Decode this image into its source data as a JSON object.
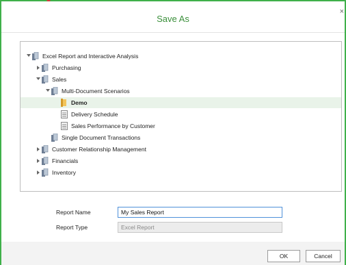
{
  "dialog": {
    "title": "Save As",
    "close_glyph": "×"
  },
  "tree": [
    {
      "label": "Excel Report and Interactive Analysis",
      "expanded": true,
      "icon": "document-folder-icon"
    },
    {
      "label": "Purchasing",
      "expanded": false,
      "icon": "document-folder-icon"
    },
    {
      "label": "Sales",
      "expanded": true,
      "icon": "document-folder-icon"
    },
    {
      "label": "Multi-Document Scenarios",
      "expanded": true,
      "icon": "document-folder-icon"
    },
    {
      "label": "Demo",
      "selected": true,
      "icon": "folder-icon"
    },
    {
      "label": "Delivery Schedule",
      "icon": "report-icon"
    },
    {
      "label": "Sales Performance by Customer",
      "icon": "report-icon"
    },
    {
      "label": "Single Document Transactions",
      "icon": "document-folder-icon"
    },
    {
      "label": "Customer Relationship Management",
      "expanded": false,
      "icon": "document-folder-icon"
    },
    {
      "label": "Financials",
      "expanded": false,
      "icon": "document-folder-icon"
    },
    {
      "label": "Inventory",
      "expanded": false,
      "icon": "document-folder-icon"
    }
  ],
  "form": {
    "report_name_label": "Report Name",
    "report_name_value": "My Sales Report",
    "report_type_label": "Report Type",
    "report_type_value": "Excel Report"
  },
  "buttons": {
    "ok": "OK",
    "cancel": "Cancel"
  },
  "colors": {
    "accent_green": "#3fb04a",
    "title_green": "#3a8f3a",
    "selection": "#e9f3e9",
    "focus_blue": "#4d90d9"
  }
}
